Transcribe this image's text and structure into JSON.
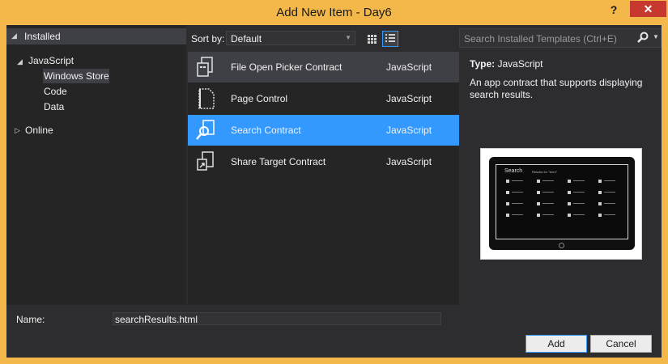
{
  "window": {
    "title": "Add New Item - Day6",
    "help_label": "?",
    "close_label": "✕"
  },
  "tree": {
    "installed_label": "Installed",
    "items": [
      {
        "label": "JavaScript",
        "expanded": true
      },
      {
        "label": "Windows Store",
        "selected": true
      },
      {
        "label": "Code"
      },
      {
        "label": "Data"
      }
    ],
    "online_label": "Online"
  },
  "toolbar": {
    "sort_label": "Sort by:",
    "sort_value": "Default"
  },
  "search": {
    "placeholder": "Search Installed Templates (Ctrl+E)"
  },
  "templates": [
    {
      "name": "File Open Picker Contract",
      "language": "JavaScript",
      "state": "hover",
      "icon": "file-picker-icon"
    },
    {
      "name": "Page Control",
      "language": "JavaScript",
      "state": "normal",
      "icon": "page-icon"
    },
    {
      "name": "Search Contract",
      "language": "JavaScript",
      "state": "selected",
      "icon": "search-contract-icon"
    },
    {
      "name": "Share Target Contract",
      "language": "JavaScript",
      "state": "normal",
      "icon": "share-target-icon"
    }
  ],
  "details": {
    "type_label": "Type:",
    "type_value": "JavaScript",
    "description": "An app contract that supports displaying search results.",
    "preview_title": "Search",
    "preview_subtitle": "Results for \"term\""
  },
  "footer": {
    "name_label": "Name:",
    "name_value": "searchResults.html",
    "add_label": "Add",
    "cancel_label": "Cancel"
  },
  "colors": {
    "title_bar": "#f3b849",
    "selection": "#3399ff",
    "close_button": "#c7392f",
    "background": "#2d2d30"
  }
}
